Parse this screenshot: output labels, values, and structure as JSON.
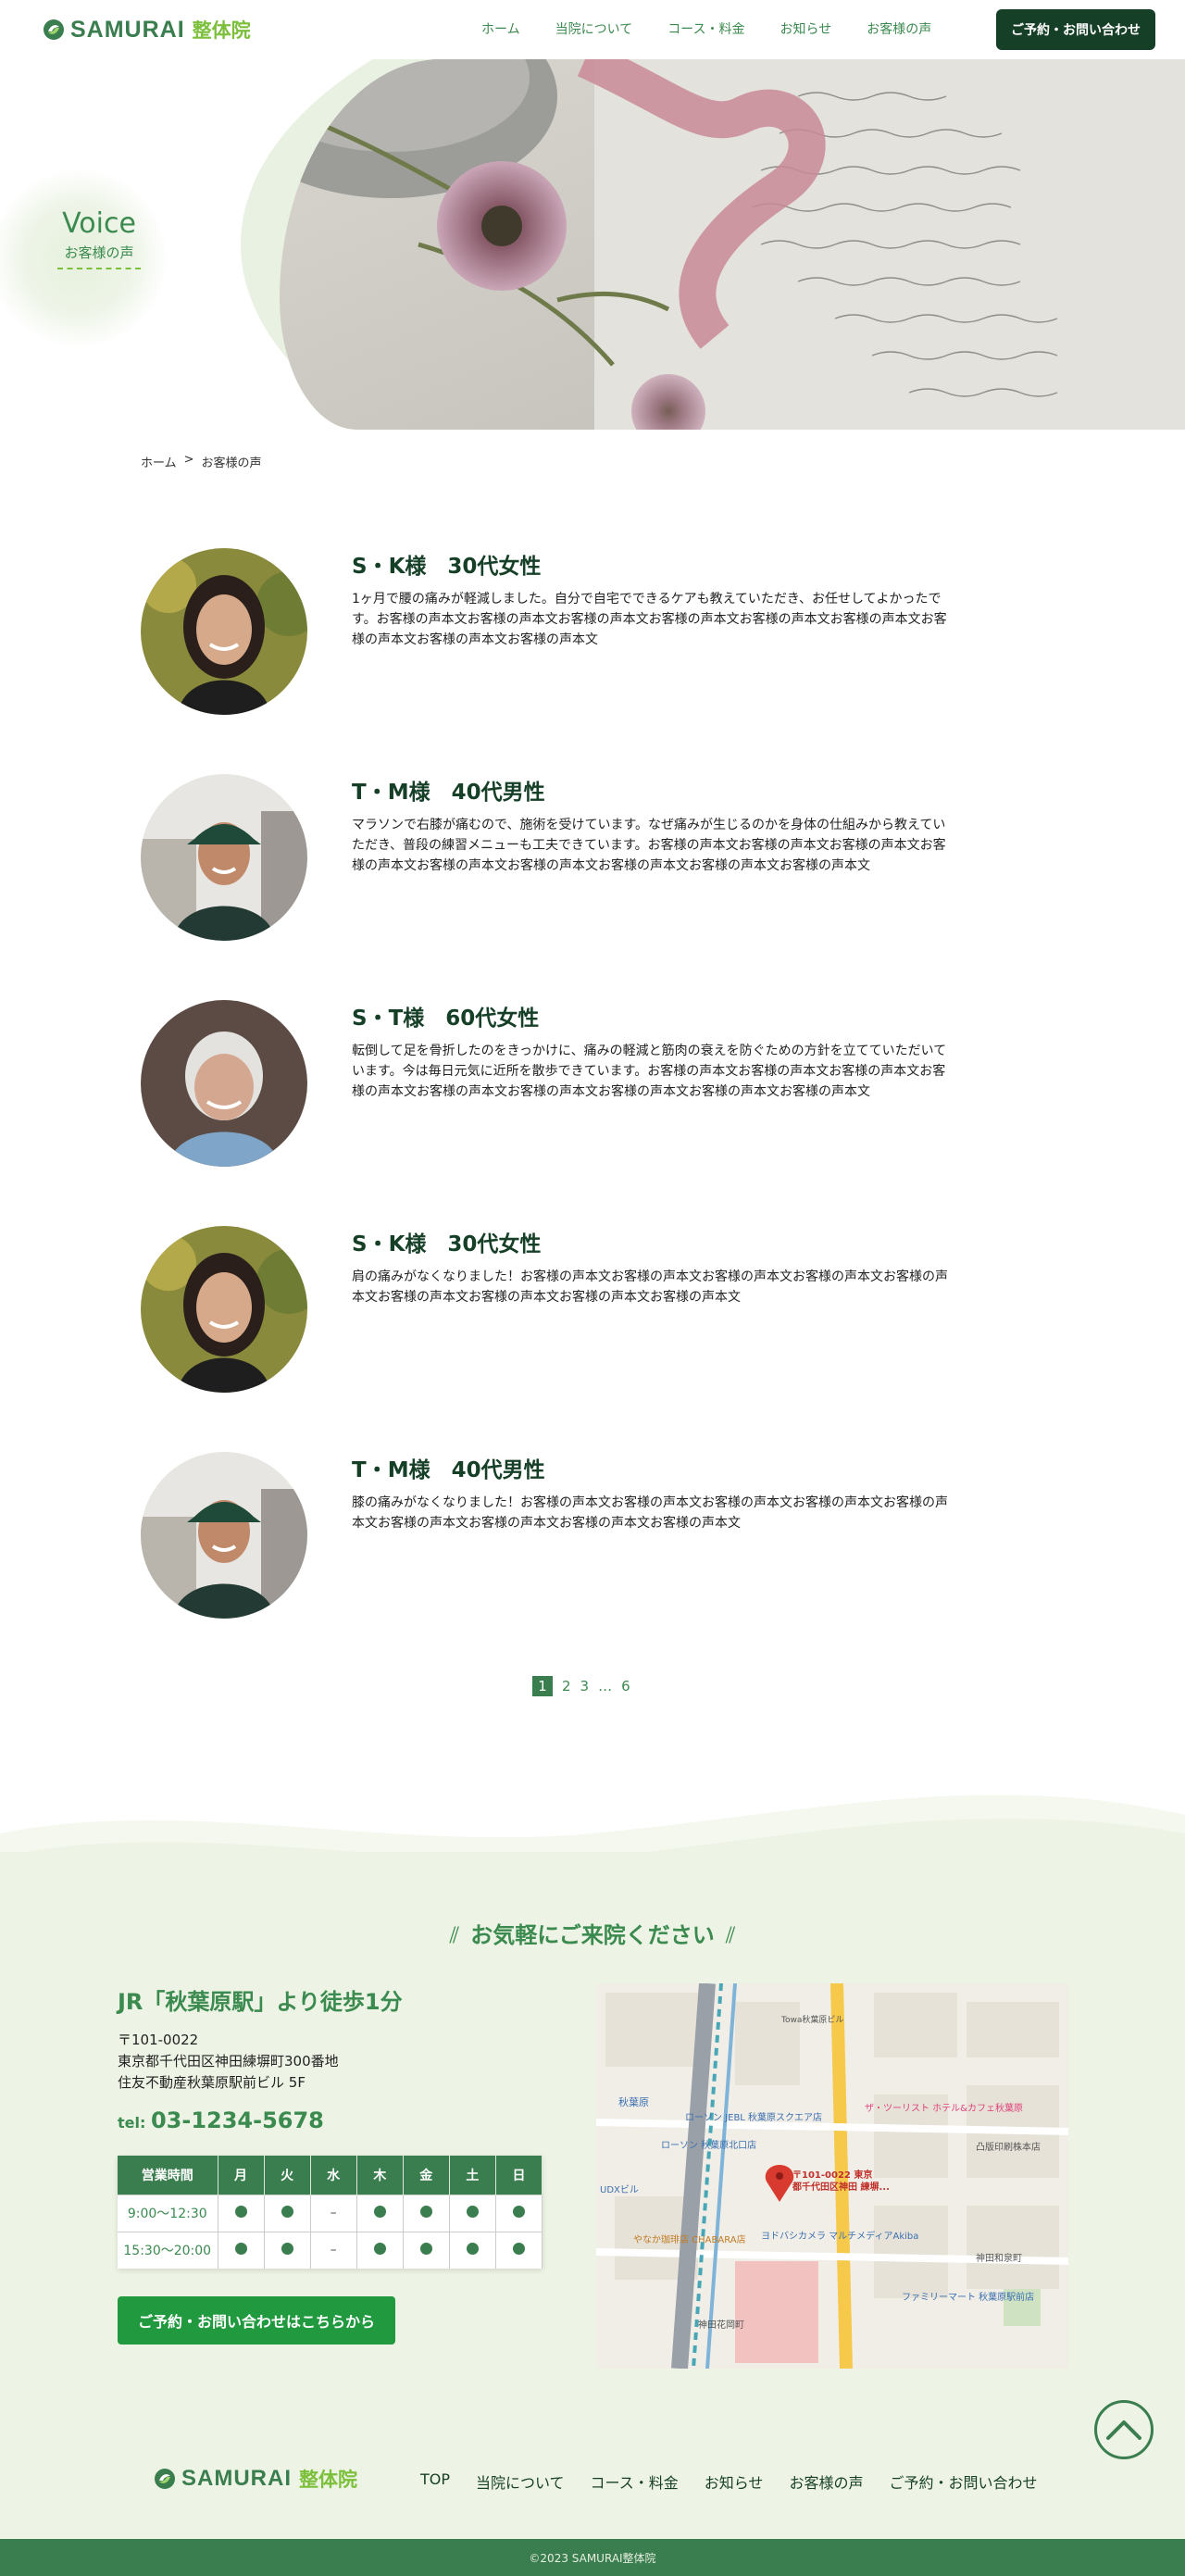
{
  "header": {
    "logo_text": "SAMURAI",
    "logo_sub": "整体院",
    "nav": [
      "ホーム",
      "当院について",
      "コース・料金",
      "お知らせ",
      "お客様の声"
    ],
    "reserve_label": "ご予約・お問い合わせ"
  },
  "hero": {
    "title_en": "Voice",
    "title_ja": "お客様の声"
  },
  "breadcrumb": {
    "home": "ホーム",
    "sep": ">",
    "current": "お客様の声"
  },
  "voices": [
    {
      "name": "S・K様　30代女性",
      "text": "1ヶ月で腰の痛みが軽減しました。自分で自宅でできるケアも教えていただき、お任せしてよかったです。お客様の声本文お客様の声本文お客様の声本文お客様の声本文お客様の声本文お客様の声本文お客様の声本文お客様の声本文お客様の声本文"
    },
    {
      "name": "T・M様　40代男性",
      "text": "マラソンで右膝が痛むので、施術を受けています。なぜ痛みが生じるのかを身体の仕組みから教えていただき、普段の練習メニューも工夫できています。お客様の声本文お客様の声本文お客様の声本文お客様の声本文お客様の声本文お客様の声本文お客様の声本文お客様の声本文お客様の声本文"
    },
    {
      "name": "S・T様　60代女性",
      "text": "転倒して足を骨折したのをきっかけに、痛みの軽減と筋肉の衰えを防ぐための方針を立てていただいています。今は毎日元気に近所を散歩できています。お客様の声本文お客様の声本文お客様の声本文お客様の声本文お客様の声本文お客様の声本文お客様の声本文お客様の声本文お客様の声本文"
    },
    {
      "name": "S・K様　30代女性",
      "text": "肩の痛みがなくなりました！お客様の声本文お客様の声本文お客様の声本文お客様の声本文お客様の声本文お客様の声本文お客様の声本文お客様の声本文お客様の声本文"
    },
    {
      "name": "T・M様　40代男性",
      "text": "膝の痛みがなくなりました！お客様の声本文お客様の声本文お客様の声本文お客様の声本文お客様の声本文お客様の声本文お客様の声本文お客様の声本文お客様の声本文"
    }
  ],
  "pagination": {
    "current": "1",
    "pages": [
      "2",
      "3"
    ],
    "ellipsis": "…",
    "last": "6"
  },
  "contact": {
    "title": "お気軽にご来院ください",
    "slash": "⫽",
    "access": "JR「秋葉原駅」より徒歩1分",
    "postal": "〒101-0022",
    "address1": "東京都千代田区神田練塀町300番地",
    "address2": "住友不動産秋葉原駅前ビル 5F",
    "tel_label": "tel:",
    "tel": "03-1234-5678",
    "hours_header": "営業時間",
    "days": [
      "月",
      "火",
      "水",
      "木",
      "金",
      "土",
      "日"
    ],
    "slots": [
      {
        "time": "9:00〜12:30",
        "open": [
          true,
          true,
          false,
          true,
          true,
          true,
          true
        ]
      },
      {
        "time": "15:30〜20:00",
        "open": [
          true,
          true,
          false,
          true,
          true,
          true,
          true
        ]
      }
    ],
    "closed_mark": "–",
    "button": "ご予約・お問い合わせはこちらから"
  },
  "map": {
    "pin_label_1": "〒101-0022 東京",
    "pin_label_2": "都千代田区神田 練塀...",
    "labels": [
      "秋葉原",
      "ローソン JEBL 秋葉原スクエア店",
      "ローソン 秋葉原北口店",
      "ザ・ツーリスト ホテル&カフェ秋葉原",
      "ヨドバシカメラ マルチメディアAkiba",
      "ファミリーマート 秋葉原駅前店",
      "やなか珈琲店 CHABARA店",
      "神田和泉町",
      "凸版印刷株本店",
      "Towa秋葉原ビル",
      "UDXビル",
      "神田花岡町"
    ]
  },
  "footer": {
    "nav": [
      "TOP",
      "当院について",
      "コース・料金",
      "お知らせ",
      "お客様の声",
      "ご予約・お問い合わせ"
    ],
    "copyright": "©2023 SAMURAI整体院"
  },
  "colors": {
    "brand": "#3a7d4e",
    "lime": "#7cbf3b",
    "dark": "#163f27",
    "bg_green": "#eef4e5",
    "cta": "#219a3f"
  }
}
